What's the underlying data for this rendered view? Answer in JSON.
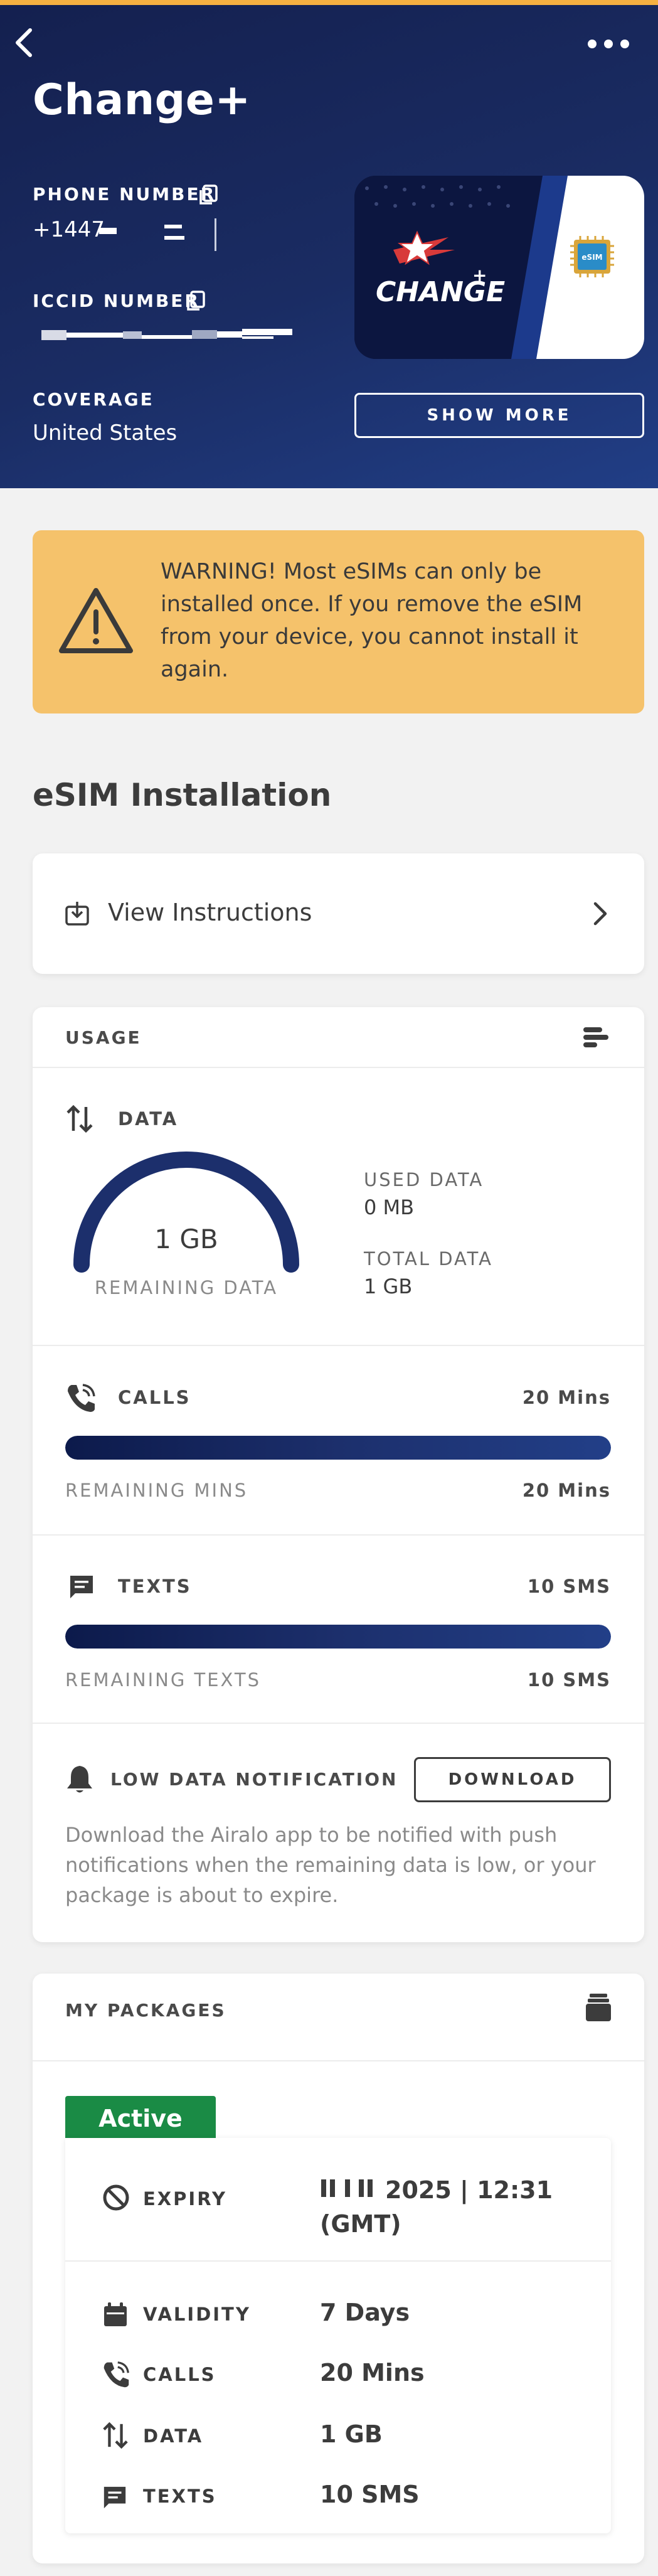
{
  "header": {
    "title": "Change+",
    "phone_label": "PHONE NUMBER",
    "phone_value": "+1447",
    "iccid_label": "ICCID NUMBER",
    "coverage_label": "COVERAGE",
    "coverage_value": "United States",
    "show_more": "SHOW MORE",
    "card_brand": "CHANGE",
    "card_chip": "eSIM"
  },
  "warning": {
    "text": "WARNING! Most eSIMs can only be installed once. If you remove the eSIM from your device, you cannot install it again."
  },
  "installation": {
    "title": "eSIM Installation",
    "instructions_label": "View Instructions"
  },
  "usage": {
    "title": "USAGE",
    "data": {
      "label": "DATA",
      "remaining_value": "1 GB",
      "remaining_label": "REMAINING DATA",
      "remaining_fraction": 1.0,
      "used_label": "USED DATA",
      "used_value": "0 MB",
      "total_label": "TOTAL DATA",
      "total_value": "1 GB"
    },
    "calls": {
      "label": "CALLS",
      "total": "20 Mins",
      "remaining_label": "REMAINING MINS",
      "remaining": "20 Mins",
      "fraction": 1.0
    },
    "texts": {
      "label": "TEXTS",
      "total": "10 SMS",
      "remaining_label": "REMAINING TEXTS",
      "remaining": "10 SMS",
      "fraction": 1.0
    },
    "notification": {
      "label": "LOW DATA NOTIFICATION",
      "button": "DOWNLOAD",
      "text": "Download the Airalo app to be notified with push notifications when the remaining data is low, or your package is about to expire."
    }
  },
  "packages": {
    "title": "MY PACKAGES",
    "status": "Active",
    "expiry_label": "EXPIRY",
    "expiry_value": "2025 | 12:31 (GMT)",
    "validity_label": "VALIDITY",
    "validity_value": "7 Days",
    "calls_label": "CALLS",
    "calls_value": "20 Mins",
    "data_label": "DATA",
    "data_value": "1 GB",
    "texts_label": "TEXTS",
    "texts_value": "10 SMS"
  },
  "colors": {
    "header_bg": "#1a2c63",
    "warning_bg": "#f5c26b",
    "bar_fill": "#1c2f6c",
    "active_badge": "#1a8b45",
    "top_accent": "#f5b041"
  }
}
